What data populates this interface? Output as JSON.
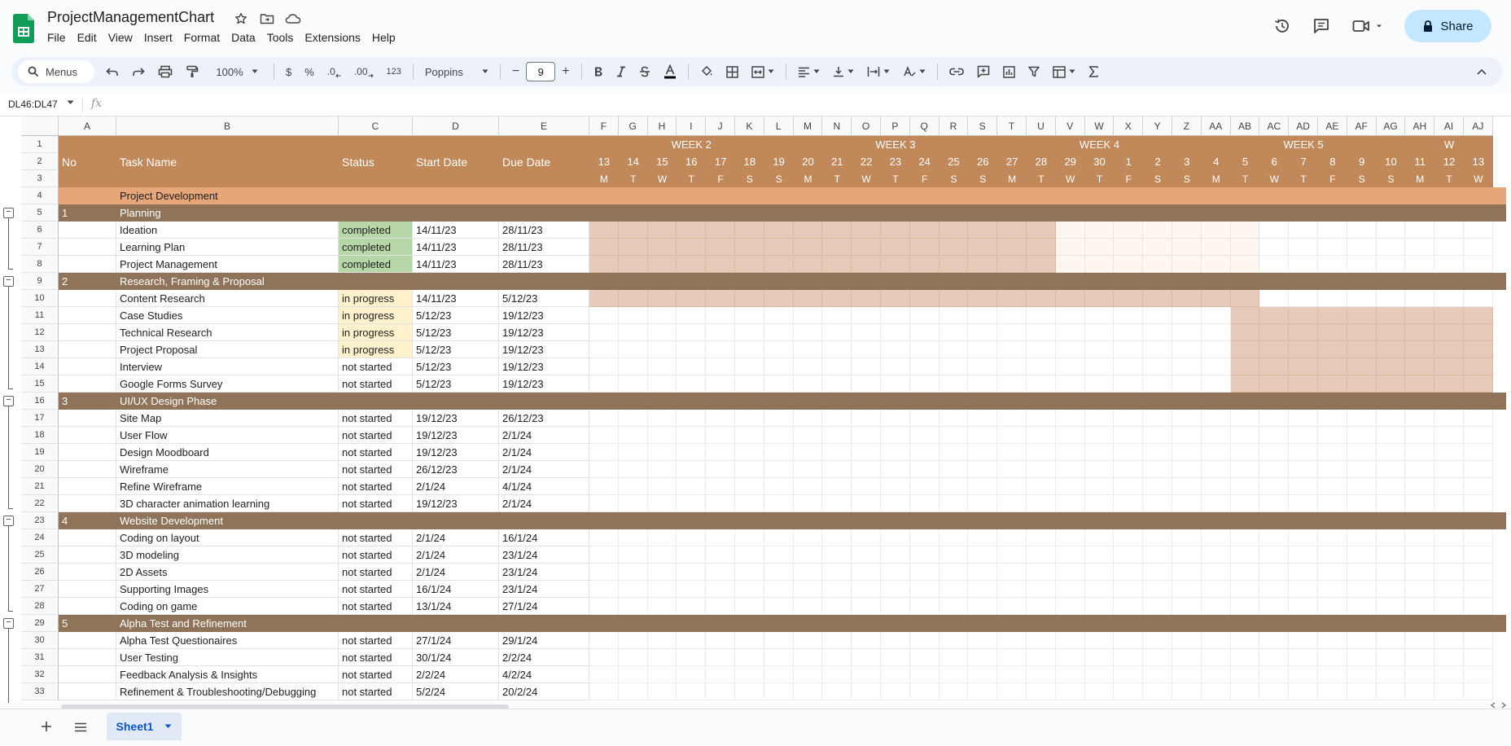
{
  "app": {
    "title": "ProjectManagementChart",
    "menu": [
      "File",
      "Edit",
      "View",
      "Insert",
      "Format",
      "Data",
      "Tools",
      "Extensions",
      "Help"
    ],
    "share_label": "Share"
  },
  "toolbar": {
    "search_label": "Menus",
    "zoom": "100%",
    "currency": "$",
    "percent": "%",
    "dec_decrease": ".0",
    "dec_increase": ".00",
    "format_number": "123",
    "font": "Poppins",
    "font_size": "9",
    "minus": "−",
    "plus": "+"
  },
  "formula_bar": {
    "name_box": "DL46:DL47",
    "fx": "fx",
    "value": ""
  },
  "sheet": {
    "tab_name": "Sheet1"
  },
  "columns": {
    "left": [
      "A",
      "B",
      "C",
      "D",
      "E"
    ],
    "gantt": [
      "F",
      "G",
      "H",
      "I",
      "J",
      "K",
      "L",
      "M",
      "N",
      "O",
      "P",
      "Q",
      "R",
      "S",
      "T",
      "U",
      "V",
      "W",
      "X",
      "Y",
      "Z",
      "AA",
      "AB",
      "AC",
      "AD",
      "AE",
      "AF",
      "AG",
      "AH",
      "AI",
      "AJ"
    ]
  },
  "gantt_header": {
    "weeks": [
      {
        "label": "WEEK 2",
        "span": 7
      },
      {
        "label": "WEEK 3",
        "span": 7
      },
      {
        "label": "WEEK 4",
        "span": 7
      },
      {
        "label": "WEEK 5",
        "span": 7
      },
      {
        "label": "W",
        "span": 3
      }
    ],
    "dates": [
      "13",
      "14",
      "15",
      "16",
      "17",
      "18",
      "19",
      "20",
      "21",
      "22",
      "23",
      "24",
      "25",
      "26",
      "27",
      "28",
      "29",
      "30",
      "1",
      "2",
      "3",
      "4",
      "5",
      "6",
      "7",
      "8",
      "9",
      "10",
      "11",
      "12",
      "13"
    ],
    "days": [
      "M",
      "T",
      "W",
      "T",
      "F",
      "S",
      "S",
      "M",
      "T",
      "W",
      "T",
      "F",
      "S",
      "S",
      "M",
      "T",
      "W",
      "T",
      "F",
      "S",
      "S",
      "M",
      "T",
      "W",
      "T",
      "F",
      "S",
      "S",
      "M",
      "T",
      "W"
    ]
  },
  "table_header": {
    "no": "No",
    "task": "Task Name",
    "status": "Status",
    "start": "Start Date",
    "due": "Due Date"
  },
  "project_title": "Project Development",
  "rows": [
    {
      "n": 5,
      "type": "section",
      "no": "1",
      "task": "Planning"
    },
    {
      "n": 6,
      "type": "task",
      "task": "Ideation",
      "status": "completed",
      "start": "14/11/23",
      "due": "28/11/23",
      "bar": [
        0,
        16
      ],
      "tint": [
        16,
        23
      ]
    },
    {
      "n": 7,
      "type": "task",
      "task": "Learning Plan",
      "status": "completed",
      "start": "14/11/23",
      "due": "28/11/23",
      "bar": [
        0,
        16
      ],
      "tint": [
        16,
        23
      ]
    },
    {
      "n": 8,
      "type": "task",
      "task": "Project Management",
      "status": "completed",
      "start": "14/11/23",
      "due": "28/11/23",
      "bar": [
        0,
        16
      ],
      "tint": [
        16,
        23
      ]
    },
    {
      "n": 9,
      "type": "section",
      "no": "2",
      "task": "Research, Framing & Proposal"
    },
    {
      "n": 10,
      "type": "task",
      "task": "Content Research",
      "status": "in progress",
      "start": "14/11/23",
      "due": "5/12/23",
      "bar": [
        0,
        23
      ]
    },
    {
      "n": 11,
      "type": "task",
      "task": "Case Studies",
      "status": "in progress",
      "start": "5/12/23",
      "due": "19/12/23",
      "bar": [
        22,
        31
      ]
    },
    {
      "n": 12,
      "type": "task",
      "task": "Technical Research",
      "status": "in progress",
      "start": "5/12/23",
      "due": "19/12/23",
      "bar": [
        22,
        31
      ]
    },
    {
      "n": 13,
      "type": "task",
      "task": "Project Proposal",
      "status": "in progress",
      "start": "5/12/23",
      "due": "19/12/23",
      "bar": [
        22,
        31
      ]
    },
    {
      "n": 14,
      "type": "task",
      "task": "Interview",
      "status": "not started",
      "start": "5/12/23",
      "due": "19/12/23",
      "bar": [
        22,
        31
      ]
    },
    {
      "n": 15,
      "type": "task",
      "task": "Google Forms Survey",
      "status": "not started",
      "start": "5/12/23",
      "due": "19/12/23",
      "bar": [
        22,
        31
      ]
    },
    {
      "n": 16,
      "type": "section",
      "no": "3",
      "task": "UI/UX Design Phase"
    },
    {
      "n": 17,
      "type": "task",
      "task": "Site Map",
      "status": "not started",
      "start": "19/12/23",
      "due": "26/12/23"
    },
    {
      "n": 18,
      "type": "task",
      "task": "User Flow",
      "status": "not started",
      "start": "19/12/23",
      "due": "2/1/24"
    },
    {
      "n": 19,
      "type": "task",
      "task": "Design Moodboard",
      "status": "not started",
      "start": "19/12/23",
      "due": "2/1/24"
    },
    {
      "n": 20,
      "type": "task",
      "task": "Wireframe",
      "status": "not started",
      "start": "26/12/23",
      "due": "2/1/24"
    },
    {
      "n": 21,
      "type": "task",
      "task": "Refine Wireframe",
      "status": "not started",
      "start": "2/1/24",
      "due": "4/1/24"
    },
    {
      "n": 22,
      "type": "task",
      "task": "3D character animation learning",
      "status": "not started",
      "start": "19/12/23",
      "due": "2/1/24"
    },
    {
      "n": 23,
      "type": "section",
      "no": "4",
      "task": "Website Development"
    },
    {
      "n": 24,
      "type": "task",
      "task": "Coding on layout",
      "status": "not started",
      "start": "2/1/24",
      "due": "16/1/24"
    },
    {
      "n": 25,
      "type": "task",
      "task": "3D modeling",
      "status": "not started",
      "start": "2/1/24",
      "due": "23/1/24"
    },
    {
      "n": 26,
      "type": "task",
      "task": "2D Assets",
      "status": "not started",
      "start": "2/1/24",
      "due": "23/1/24"
    },
    {
      "n": 27,
      "type": "task",
      "task": "Supporting Images",
      "status": "not started",
      "start": "16/1/24",
      "due": "23/1/24"
    },
    {
      "n": 28,
      "type": "task",
      "task": "Coding on game",
      "status": "not started",
      "start": "13/1/24",
      "due": "27/1/24"
    },
    {
      "n": 29,
      "type": "section",
      "no": "5",
      "task": "Alpha Test and Refinement"
    },
    {
      "n": 30,
      "type": "task",
      "task": "Alpha Test Questionaires",
      "status": "not started",
      "start": "27/1/24",
      "due": "29/1/24"
    },
    {
      "n": 31,
      "type": "task",
      "task": "User Testing",
      "status": "not started",
      "start": "30/1/24",
      "due": "2/2/24"
    },
    {
      "n": 32,
      "type": "task",
      "task": "Feedback Analysis & Insights",
      "status": "not started",
      "start": "2/2/24",
      "due": "4/2/24"
    },
    {
      "n": 33,
      "type": "task",
      "task": "Refinement & Troubleshooting/Debugging",
      "status": "not started",
      "start": "5/2/24",
      "due": "20/2/24"
    }
  ],
  "colors": {
    "header_brown": "#c1885a",
    "section_brown": "#8f7459",
    "project_row": "#e6a67a",
    "completed": "#b7d7a8",
    "in_progress": "#fff2cc",
    "bar": "#e6cbba",
    "bar_tint": "#fdf6f1",
    "share": "#c2e7ff"
  }
}
